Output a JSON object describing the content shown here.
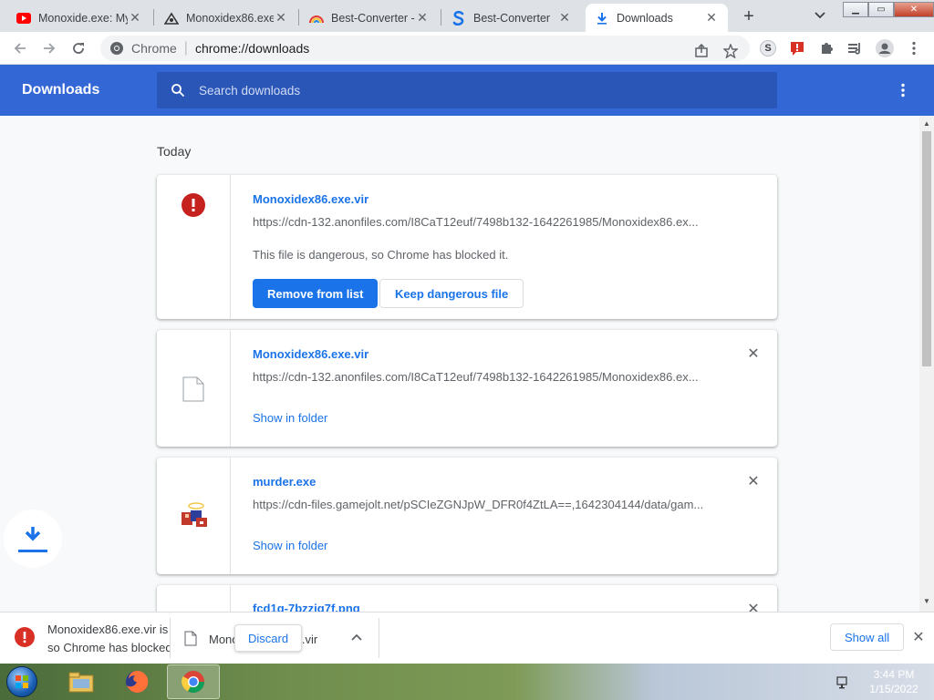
{
  "tabs": [
    {
      "title": "Monoxide.exe: My",
      "favicon": "youtube-icon"
    },
    {
      "title": "Monoxidex86.exe",
      "favicon": "anonfiles-icon"
    },
    {
      "title": "Best-Converter - (",
      "favicon": "rainbow-icon"
    },
    {
      "title": "Best-Converter",
      "favicon": "s-logo-icon"
    },
    {
      "title": "Downloads",
      "favicon": "download-icon"
    }
  ],
  "omnibox": {
    "chip": "Chrome",
    "url": "chrome://downloads"
  },
  "extensions": {
    "s_label": "S"
  },
  "header": {
    "title": "Downloads",
    "search_placeholder": "Search downloads"
  },
  "section": {
    "date": "Today"
  },
  "downloads": [
    {
      "name": "Monoxidex86.exe.vir",
      "url": "https://cdn-132.anonfiles.com/I8CaT12euf/7498b132-1642261985/Monoxidex86.ex...",
      "description": "This file is dangerous, so Chrome has blocked it.",
      "primary_action": "Remove from list",
      "secondary_action": "Keep dangerous file"
    },
    {
      "name": "Monoxidex86.exe.vir",
      "url": "https://cdn-132.anonfiles.com/I8CaT12euf/7498b132-1642261985/Monoxidex86.ex...",
      "action": "Show in folder"
    },
    {
      "name": "murder.exe",
      "url": "https://cdn-files.gamejolt.net/pSCIeZGNJpW_DFR0f4ZtLA==,1642304144/data/gam...",
      "action": "Show in folder"
    },
    {
      "name": "fcd1q-7bzzjq7f.png"
    }
  ],
  "shelf": {
    "item1_line1": "Monoxidex86.exe.vir is",
    "item1_line2": "so Chrome has blocked",
    "item2_name": "Monoxidex86.exe.vir",
    "discard_label": "Discard",
    "show_all_label": "Show all"
  },
  "clock": {
    "time": "3:44 PM",
    "date": "1/15/2022"
  },
  "colors": {
    "accent": "#1a73e8",
    "header_bg": "#3367d6",
    "danger": "#d93025"
  }
}
